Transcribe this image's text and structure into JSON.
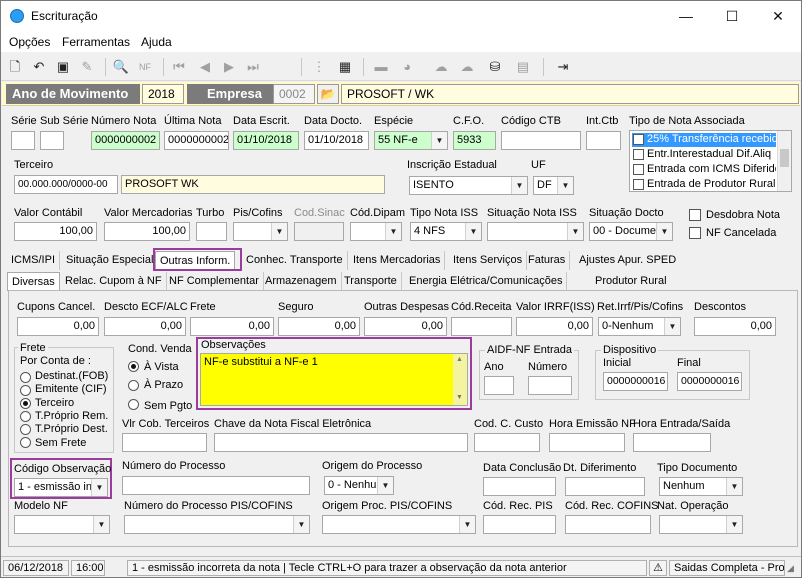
{
  "window": {
    "title": "Escrituração",
    "minimize": "—",
    "maximize": "☐",
    "close": "✕"
  },
  "menu": [
    "Opções",
    "Ferramentas",
    "Ajuda"
  ],
  "toolbar": {
    "icons": [
      "new-doc-icon",
      "undo-icon",
      "save-icon",
      "delete-icon",
      "print-preview-icon",
      "nfe-icon",
      "first-record-icon",
      "prev-record-icon",
      "next-record-icon",
      "last-record-icon",
      "tree-icon",
      "calculator-icon",
      "folder-icon",
      "pie-chart-icon",
      "cloud-icon",
      "tax-icon",
      "exit-icon"
    ]
  },
  "header": {
    "ano_label": "Ano de Movimento",
    "ano_value": "2018",
    "empresa_label": "Empresa",
    "empresa_code": "0002",
    "empresa_name": "PROSOFT / WK"
  },
  "row1": {
    "labels": {
      "serie": "Série",
      "subserie": "Sub Série",
      "numero": "Número Nota",
      "ultima": "Última Nota",
      "data_escrit": "Data Escrit.",
      "data_docto": "Data Docto.",
      "especie": "Espécie",
      "cfo": "C.F.O.",
      "codigo_ctb": "Código CTB",
      "int_ctb": "Int.Ctb",
      "tipo_nota": "Tipo de Nota Associada"
    },
    "values": {
      "numero": "0000000002",
      "ultima": "0000000002",
      "data_escrit": "01/10/2018",
      "data_docto": "01/10/2018",
      "especie": "55  NF-e",
      "cfo": "5933"
    },
    "tipo_nota_items": [
      "25% Transferência recebida",
      "Entr.Interestadual Dif.Aliq",
      "Entrada com ICMS Diferido",
      "Entrada de Produtor Rural"
    ]
  },
  "row2": {
    "labels": {
      "terceiro": "Terceiro",
      "inscricao": "Inscrição Estadual",
      "uf": "UF"
    },
    "values": {
      "terceiro_code": "00.000.000/0000-00",
      "terceiro_name": "PROSOFT WK",
      "inscricao": "ISENTO",
      "uf": "DF"
    }
  },
  "row3": {
    "labels": {
      "valor_contabil": "Valor Contábil",
      "valor_merc": "Valor Mercadorias",
      "turbo": "Turbo",
      "pis": "Pis/Cofins",
      "cod_sinac": "Cod.Sinac",
      "cod_dipam": "Cód.Dipam",
      "tipo_iss": "Tipo Nota ISS",
      "sit_iss": "Situação Nota ISS",
      "sit_docto": "Situação Docto"
    },
    "values": {
      "valor_contabil": "100,00",
      "valor_merc": "100,00",
      "tipo_iss": "4  NFS",
      "sit_docto": "00 - Documen"
    },
    "checks": {
      "desdobra": "Desdobra Nota",
      "cancelada": "NF Cancelada"
    }
  },
  "tabs1": [
    "ICMS/IPI",
    "Situação Especial",
    "Outras Inform.",
    "Conhec. Transporte",
    "Itens Mercadorias",
    "Itens Serviços",
    "Faturas",
    "Ajustes Apur. SPED"
  ],
  "tabs2": [
    "Diversas",
    "Relac. Cupom à NF",
    "NF Complementar",
    "Armazenagem",
    "Transporte",
    "Energia Elétrica/Comunicações",
    "Produtor Rural"
  ],
  "diversas": {
    "labels": {
      "cupons": "Cupons Cancel.",
      "descto": "Descto ECF/ALC",
      "frete": "Frete",
      "seguro": "Seguro",
      "outras": "Outras Despesas",
      "cod_receita": "Cód.Receita",
      "valor_irrf": "Valor IRRF(ISS)",
      "ret_irrf": "Ret.Irrf/Pis/Cofins",
      "descontos": "Descontos"
    },
    "values": {
      "cupons": "0,00",
      "descto": "0,00",
      "frete": "0,00",
      "seguro": "0,00",
      "outras": "0,00",
      "valor_irrf": "0,00",
      "ret_irrf": "0-Nenhum",
      "descontos": "0,00"
    },
    "frete_group": {
      "title": "Frete",
      "subtitle": "Por Conta de :",
      "options": [
        "Destinat.(FOB)",
        "Emitente (CIF)",
        "Terceiro",
        "T.Próprio Rem.",
        "T.Próprio Dest.",
        "Sem Frete"
      ],
      "selected": "Terceiro"
    },
    "cond_venda": {
      "title": "Cond. Venda",
      "options": [
        "À Vista",
        "À Prazo",
        "Sem Pgto"
      ],
      "selected": "À Vista"
    },
    "observacoes": {
      "label": "Observações",
      "value": "NF-e substitui a NF-e 1"
    },
    "aidf": {
      "title": "AIDF-NF Entrada",
      "ano": "Ano",
      "numero": "Número"
    },
    "dispositivo": {
      "title": "Dispositivo",
      "inicial": "Inicial",
      "final": "Final",
      "inicial_value": "0000000016",
      "final_value": "0000000016"
    },
    "labels2": {
      "vlr_cob": "Vlr Cob. Terceiros",
      "chave": "Chave da Nota Fiscal Eletrônica",
      "cod_custo": "Cod. C. Custo",
      "hora_emissao": "Hora Emissão NF",
      "hora_entrada": "Hora Entrada/Saída"
    },
    "labels3": {
      "cod_obs": "Código Observação",
      "num_processo": "Número do Processo",
      "origem_processo": "Origem do Processo",
      "data_conclusao": "Data Conclusão",
      "dt_diferimento": "Dt. Diferimento",
      "tipo_documento": "Tipo Documento"
    },
    "values3": {
      "cod_obs": "1 - esmissão inc",
      "origem_processo": "0 - Nenhum",
      "tipo_documento": "Nenhum"
    },
    "labels4": {
      "modelo_nf": "Modelo NF",
      "num_pis": "Número do Processo PIS/COFINS",
      "origem_pis": "Origem Proc. PIS/COFINS",
      "cod_rec_pis": "Cód. Rec. PIS",
      "cod_rec_cofins": "Cód. Rec. COFINS",
      "nat_operacao": "Nat. Operação"
    }
  },
  "status": {
    "date": "06/12/2018",
    "time": "16:00",
    "message": "1 - esmissão incorreta da nota | Tecle CTRL+O para trazer a observação da nota anterior",
    "right": "Saidas Completa - Pros"
  },
  "colors": {
    "accent_highlight": "#9b3b9b",
    "yellow": "#ffff00",
    "green_field": "#ccffcc",
    "selected": "#3399ff"
  }
}
